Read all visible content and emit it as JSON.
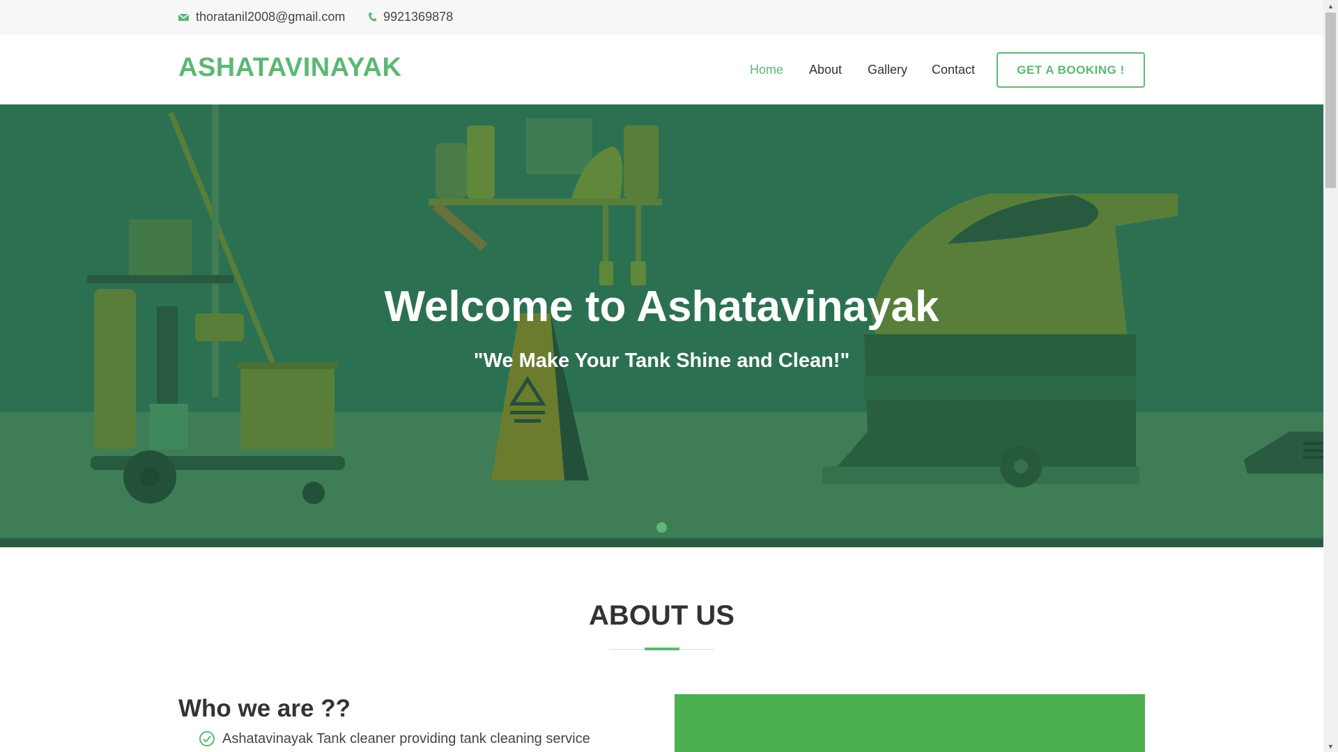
{
  "topbar": {
    "email": "thoratanil2008@gmail.com",
    "phone": "9921369878"
  },
  "header": {
    "logo": "ASHATAVINAYAK",
    "nav": [
      "Home",
      "About",
      "Gallery",
      "Contact"
    ],
    "active_nav": "Home",
    "booking_label": "GET A BOOKING !"
  },
  "hero": {
    "title": "Welcome to Ashatavinayak",
    "subtitle": "\"We Make Your Tank Shine and Clean!\""
  },
  "about": {
    "title": "ABOUT US",
    "heading": "Who we are ??",
    "bullet_1": "Ashatavinayak Tank cleaner providing tank cleaning service"
  },
  "colors": {
    "accent": "#5cb874",
    "hero_bg": "#33795b",
    "box_green": "#4caf50"
  },
  "icons": {
    "email": "envelope-icon",
    "phone": "phone-icon",
    "check": "check-circle-icon"
  }
}
